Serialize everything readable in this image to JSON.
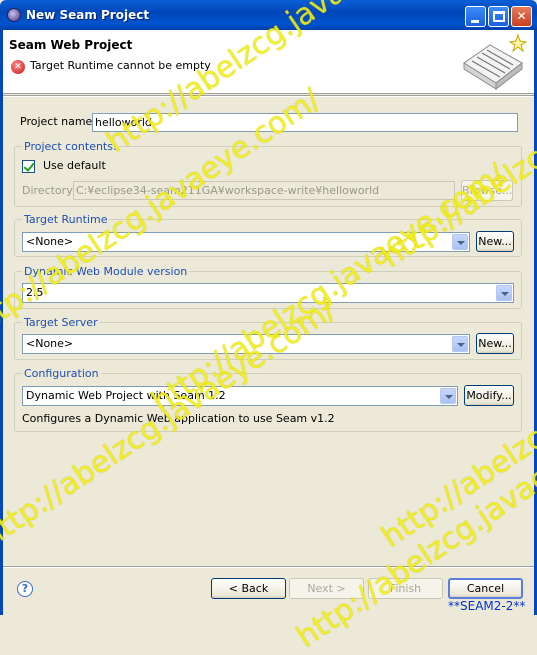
{
  "window": {
    "title": "New Seam Project"
  },
  "header": {
    "title": "Seam Web Project",
    "error_message": "Target Runtime cannot be empty"
  },
  "project_name": {
    "label": "Project name:",
    "value": "helloworld"
  },
  "project_contents": {
    "title": "Project contents:",
    "use_default_label": "Use default",
    "use_default_checked": true,
    "directory_label": "Directory:",
    "directory_value": "C:¥eclipse34-seam211GA¥workspace-write¥helloworld",
    "browse_label": "Browse..."
  },
  "target_runtime": {
    "title": "Target Runtime",
    "selected": "<None>",
    "new_label": "New..."
  },
  "dynamic_web_module": {
    "title": "Dynamic Web Module version",
    "selected": "2.5"
  },
  "target_server": {
    "title": "Target Server",
    "selected": "<None>",
    "new_label": "New..."
  },
  "configuration": {
    "title": "Configuration",
    "selected": "Dynamic Web Project with Seam 1.2",
    "modify_label": "Modify...",
    "description": "Configures a Dynamic Web application to use Seam v1.2"
  },
  "footer": {
    "back_label": "< Back",
    "next_label": "Next >",
    "finish_label": "Finish",
    "cancel_label": "Cancel"
  },
  "watermark": "http://abelzcg.javaeye.com/",
  "caption": "**SEAM2-2**",
  "colors": {
    "titlebar": "#0047b9",
    "group_title": "#1f4fb0",
    "watermark": "#f2ee14",
    "error": "#c21a1a"
  }
}
